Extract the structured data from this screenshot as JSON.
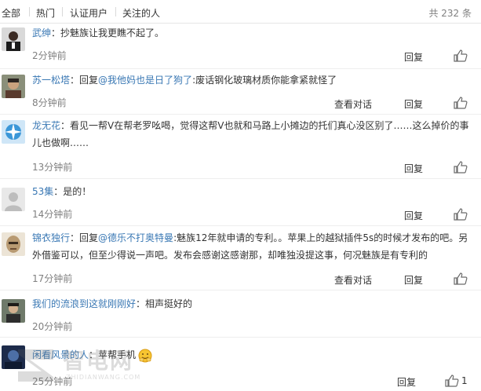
{
  "tabs": [
    "全部",
    "热门",
    "认证用户",
    "关注的人"
  ],
  "total": "共 232 条",
  "actions": {
    "reply": "回复",
    "view_conversation": "查看对话"
  },
  "comments": [
    {
      "user": "武绅",
      "sep": "：",
      "pre": "",
      "mention": "",
      "text": "抄魅族让我更瞧不起了。",
      "time": "2分钟前"
    },
    {
      "user": "苏一松塔",
      "sep": "：",
      "pre": "回复",
      "mention": "@我他妈也是日了狗了",
      "text": ":废话钢化玻璃材质你能拿紧就怪了",
      "time": "8分钟前"
    },
    {
      "user": "龙无花",
      "sep": "：",
      "pre": "",
      "mention": "",
      "text": "看见一帮V在帮老罗吆喝，觉得这帮V也就和马路上小摊边的托们真心没区别了……这么掉价的事儿也做啊……",
      "time": "13分钟前"
    },
    {
      "user": "53集",
      "sep": "：",
      "pre": "",
      "mention": "",
      "text": "是的！",
      "time": "14分钟前"
    },
    {
      "user": "锦衣独行",
      "sep": "：",
      "pre": "回复",
      "mention": "@德乐不打奥特曼",
      "text": ":魅族12年就申请的专利。。苹果上的越狱插件5s的时候才发布的吧。另外借鉴可以，但至少得说一声吧。发布会感谢这感谢那，却唯独没提这事，何况魅族是有专利的",
      "time": "17分钟前"
    },
    {
      "user": "我们的流浪到这就刚刚好",
      "sep": "：",
      "pre": "",
      "mention": "",
      "text": "相声挺好的",
      "time": "20分钟前"
    },
    {
      "user": "闲看风景的人",
      "sep": "：",
      "pre": "",
      "mention": "",
      "text": "苹帮手机",
      "time": "25分钟前",
      "like_count": "1"
    }
  ],
  "watermark": {
    "big": "智电网",
    "small": "ZHIDIANWANG.COM"
  },
  "colors": {
    "link": "#3a78b4",
    "time": "#808080",
    "divider": "#eeeeee"
  }
}
